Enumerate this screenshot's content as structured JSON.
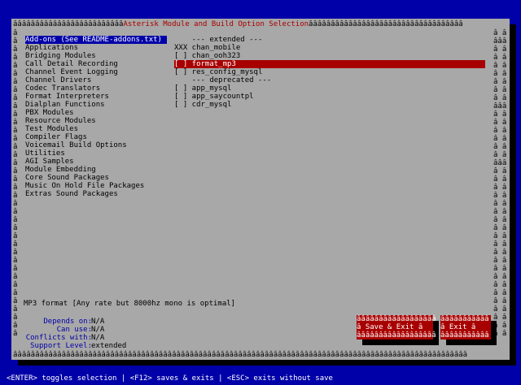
{
  "window": {
    "title": "Asterisk Module and Build Option Selection",
    "title_border_left": "âââââââââââââââââââââââââ",
    "title_border_right": "âââââââââââââââââââââââââââââââââââ",
    "bottom_border": "âââââââââââââââââââââââââââââââââââââââââââââââââââââââââââââââââââââââââââââââââââââââââââââââââââââââ",
    "edge_char": "â",
    "right_col_a": "â â",
    "right_col_scroll": "âââ"
  },
  "categories": [
    "Add-ons (See README-addons.txt)",
    "Applications",
    "Bridging Modules",
    "Call Detail Recording",
    "Channel Event Logging",
    "Channel Drivers",
    "Codec Translators",
    "Format Interpreters",
    "Dialplan Functions",
    "PBX Modules",
    "Resource Modules",
    "Test Modules",
    "Compiler Flags",
    "Voicemail Build Options",
    "Utilities",
    "AGI Samples",
    "Module Embedding",
    "Core Sound Packages",
    "Music On Hold File Packages",
    "Extras Sound Packages"
  ],
  "options": [
    {
      "text": "    --- extended ---"
    },
    {
      "text": "XXX chan_mobile"
    },
    {
      "text": "[ ] chan_ooh323"
    },
    {
      "text": "[ ] format_mp3",
      "selected": true
    },
    {
      "text": "[ ] res_config_mysql"
    },
    {
      "text": "    --- deprecated ---"
    },
    {
      "text": "[ ] app_mysql"
    },
    {
      "text": "[ ] app_saycountpl"
    },
    {
      "text": "[ ] cdr_mysql"
    }
  ],
  "description": "MP3 format [Any rate but 8000hz mono is optimal]",
  "details": {
    "depends_label": "Depends on:",
    "depends_value": "N/A",
    "canuse_label": "Can use:",
    "canuse_value": "N/A",
    "conflicts_label": "Conflicts with:",
    "conflicts_value": "N/A",
    "support_label": "Support Level:",
    "support_value": "extended"
  },
  "buttons": {
    "save_top": "ââââââââââââââââââ",
    "save_label": "â  Save & Exit  â",
    "save_bottom": "ââââââââââââââââââ",
    "exit_top": "âââââââââââ",
    "exit_label": "â  Exit  â",
    "exit_bottom": "âââââââââââ"
  },
  "footer": "<ENTER> toggles selection | <F12> saves & exits | <ESC> exits without save",
  "colors": {
    "background": "#0000a8",
    "panel": "#a8a8a8",
    "accent_red": "#a80000",
    "highlight_blue": "#0000a8"
  }
}
